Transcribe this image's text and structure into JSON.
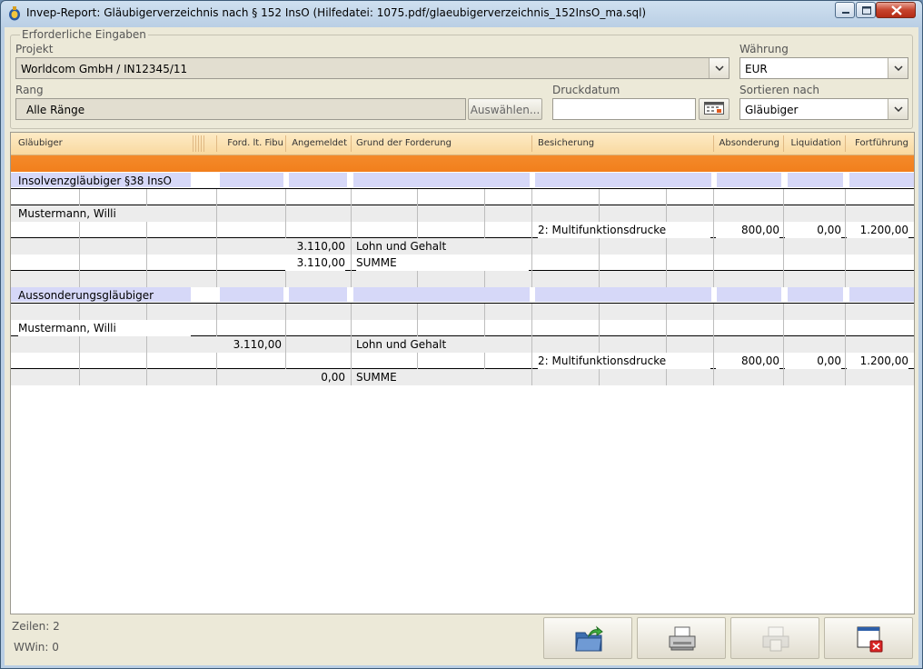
{
  "window": {
    "title": "Invep-Report: Gläubigerverzeichnis nach § 152 InsO   (Hilfedatei: 1075.pdf/glaeubigerverzeichnis_152InsO_ma.sql)"
  },
  "form": {
    "group_label": "Erforderliche Eingaben",
    "projekt_label": "Projekt",
    "projekt_value": "Worldcom GmbH / IN12345/11",
    "waehrung_label": "Währung",
    "waehrung_value": "EUR",
    "rang_label": "Rang",
    "rang_value": "Alle Ränge",
    "auswaehlen_label": "Auswählen...",
    "druckdatum_label": "Druckdatum",
    "druckdatum_value": "",
    "sortieren_label": "Sortieren nach",
    "sortieren_value": "Gläubiger"
  },
  "grid": {
    "headers": [
      "Gläubiger",
      "Ford. lt. Fibu",
      "Angemeldet",
      "Grund der Forderung",
      "Besicherung",
      "Absonderung",
      "Liquidation",
      "Fortführung"
    ],
    "rows": [
      {
        "kind": "group",
        "glaeubiger": "Insolvenzgläubiger §38 InsO"
      },
      {
        "kind": "blank"
      },
      {
        "kind": "data",
        "glaeubiger": "Mustermann, Willi",
        "fibu": "",
        "angemeldet": "",
        "grund": "",
        "besicherung": "",
        "absonderung": "",
        "liquidation": "",
        "fortfuehrung": ""
      },
      {
        "kind": "data",
        "glaeubiger": "",
        "fibu": "",
        "angemeldet": "",
        "grund": "",
        "besicherung": "2: Multifunktionsdrucke",
        "absonderung": "800,00",
        "liquidation": "0,00",
        "fortfuehrung": "1.200,00"
      },
      {
        "kind": "data",
        "glaeubiger": "",
        "fibu": "",
        "angemeldet": "3.110,00",
        "grund": "Lohn und Gehalt",
        "besicherung": "",
        "absonderung": "",
        "liquidation": "",
        "fortfuehrung": ""
      },
      {
        "kind": "data",
        "glaeubiger": "",
        "fibu": "",
        "angemeldet": "3.110,00",
        "grund": "SUMME",
        "besicherung": "",
        "absonderung": "",
        "liquidation": "",
        "fortfuehrung": ""
      },
      {
        "kind": "blank"
      },
      {
        "kind": "group",
        "glaeubiger": "Aussonderungsgläubiger"
      },
      {
        "kind": "blank"
      },
      {
        "kind": "data",
        "glaeubiger": "Mustermann, Willi",
        "fibu": "",
        "angemeldet": "",
        "grund": "",
        "besicherung": "",
        "absonderung": "",
        "liquidation": "",
        "fortfuehrung": ""
      },
      {
        "kind": "data",
        "glaeubiger": "",
        "fibu": "3.110,00",
        "angemeldet": "",
        "grund": "Lohn und Gehalt",
        "besicherung": "",
        "absonderung": "",
        "liquidation": "",
        "fortfuehrung": ""
      },
      {
        "kind": "data",
        "glaeubiger": "",
        "fibu": "",
        "angemeldet": "",
        "grund": "",
        "besicherung": "2: Multifunktionsdrucke",
        "absonderung": "800,00",
        "liquidation": "0,00",
        "fortfuehrung": "1.200,00"
      },
      {
        "kind": "data",
        "glaeubiger": "",
        "fibu": "",
        "angemeldet": "0,00",
        "grund": "SUMME",
        "besicherung": "",
        "absonderung": "",
        "liquidation": "",
        "fortfuehrung": ""
      }
    ]
  },
  "status": {
    "zeilen": "Zeilen: 2",
    "wwin": "WWin: 0"
  },
  "colors": {
    "header_bg": "#f9d9a0",
    "orange_band": "#f27f1c",
    "group_row_highlight": "#d6d8f8"
  }
}
